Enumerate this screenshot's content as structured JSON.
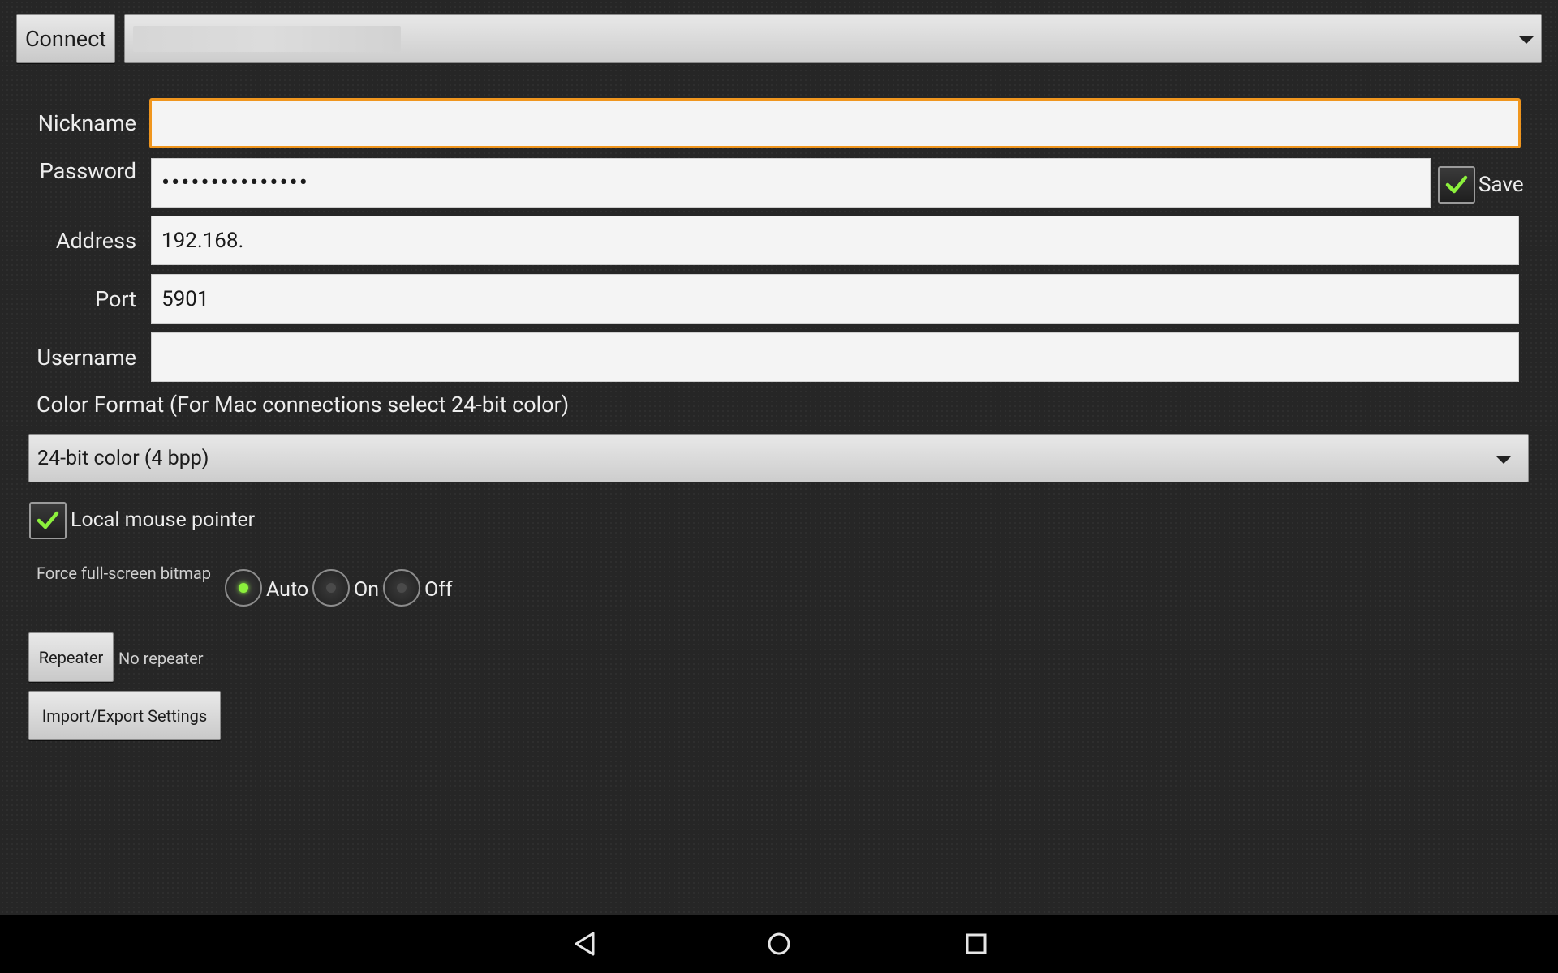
{
  "top_bar": {
    "connect_label": "Connect",
    "connection_selector_value": ""
  },
  "form": {
    "nickname": {
      "label": "Nickname",
      "value": ""
    },
    "password": {
      "label": "Password",
      "masked_value": "•••••••••••••••",
      "save_label": "Save",
      "save_checked": true
    },
    "address": {
      "label": "Address",
      "value": "192.168."
    },
    "port": {
      "label": "Port",
      "value": "5901"
    },
    "username": {
      "label": "Username",
      "value": ""
    },
    "color_format": {
      "label": "Color Format (For Mac connections select 24-bit color)",
      "selected": "24-bit color (4 bpp)"
    },
    "local_mouse_pointer": {
      "label": "Local mouse pointer",
      "checked": true
    },
    "force_fullscreen_bitmap": {
      "label": "Force full-screen bitmap",
      "options": [
        "Auto",
        "On",
        "Off"
      ],
      "selected": "Auto"
    },
    "repeater": {
      "button_label": "Repeater",
      "status": "No repeater"
    },
    "import_export_label": "Import/Export Settings"
  },
  "colors": {
    "accent_focus": "#f0961e",
    "check_green": "#8cf03c",
    "background": "#262626"
  },
  "navbar": {
    "back": "back-triangle-icon",
    "home": "home-circle-icon",
    "recents": "recents-square-icon"
  }
}
